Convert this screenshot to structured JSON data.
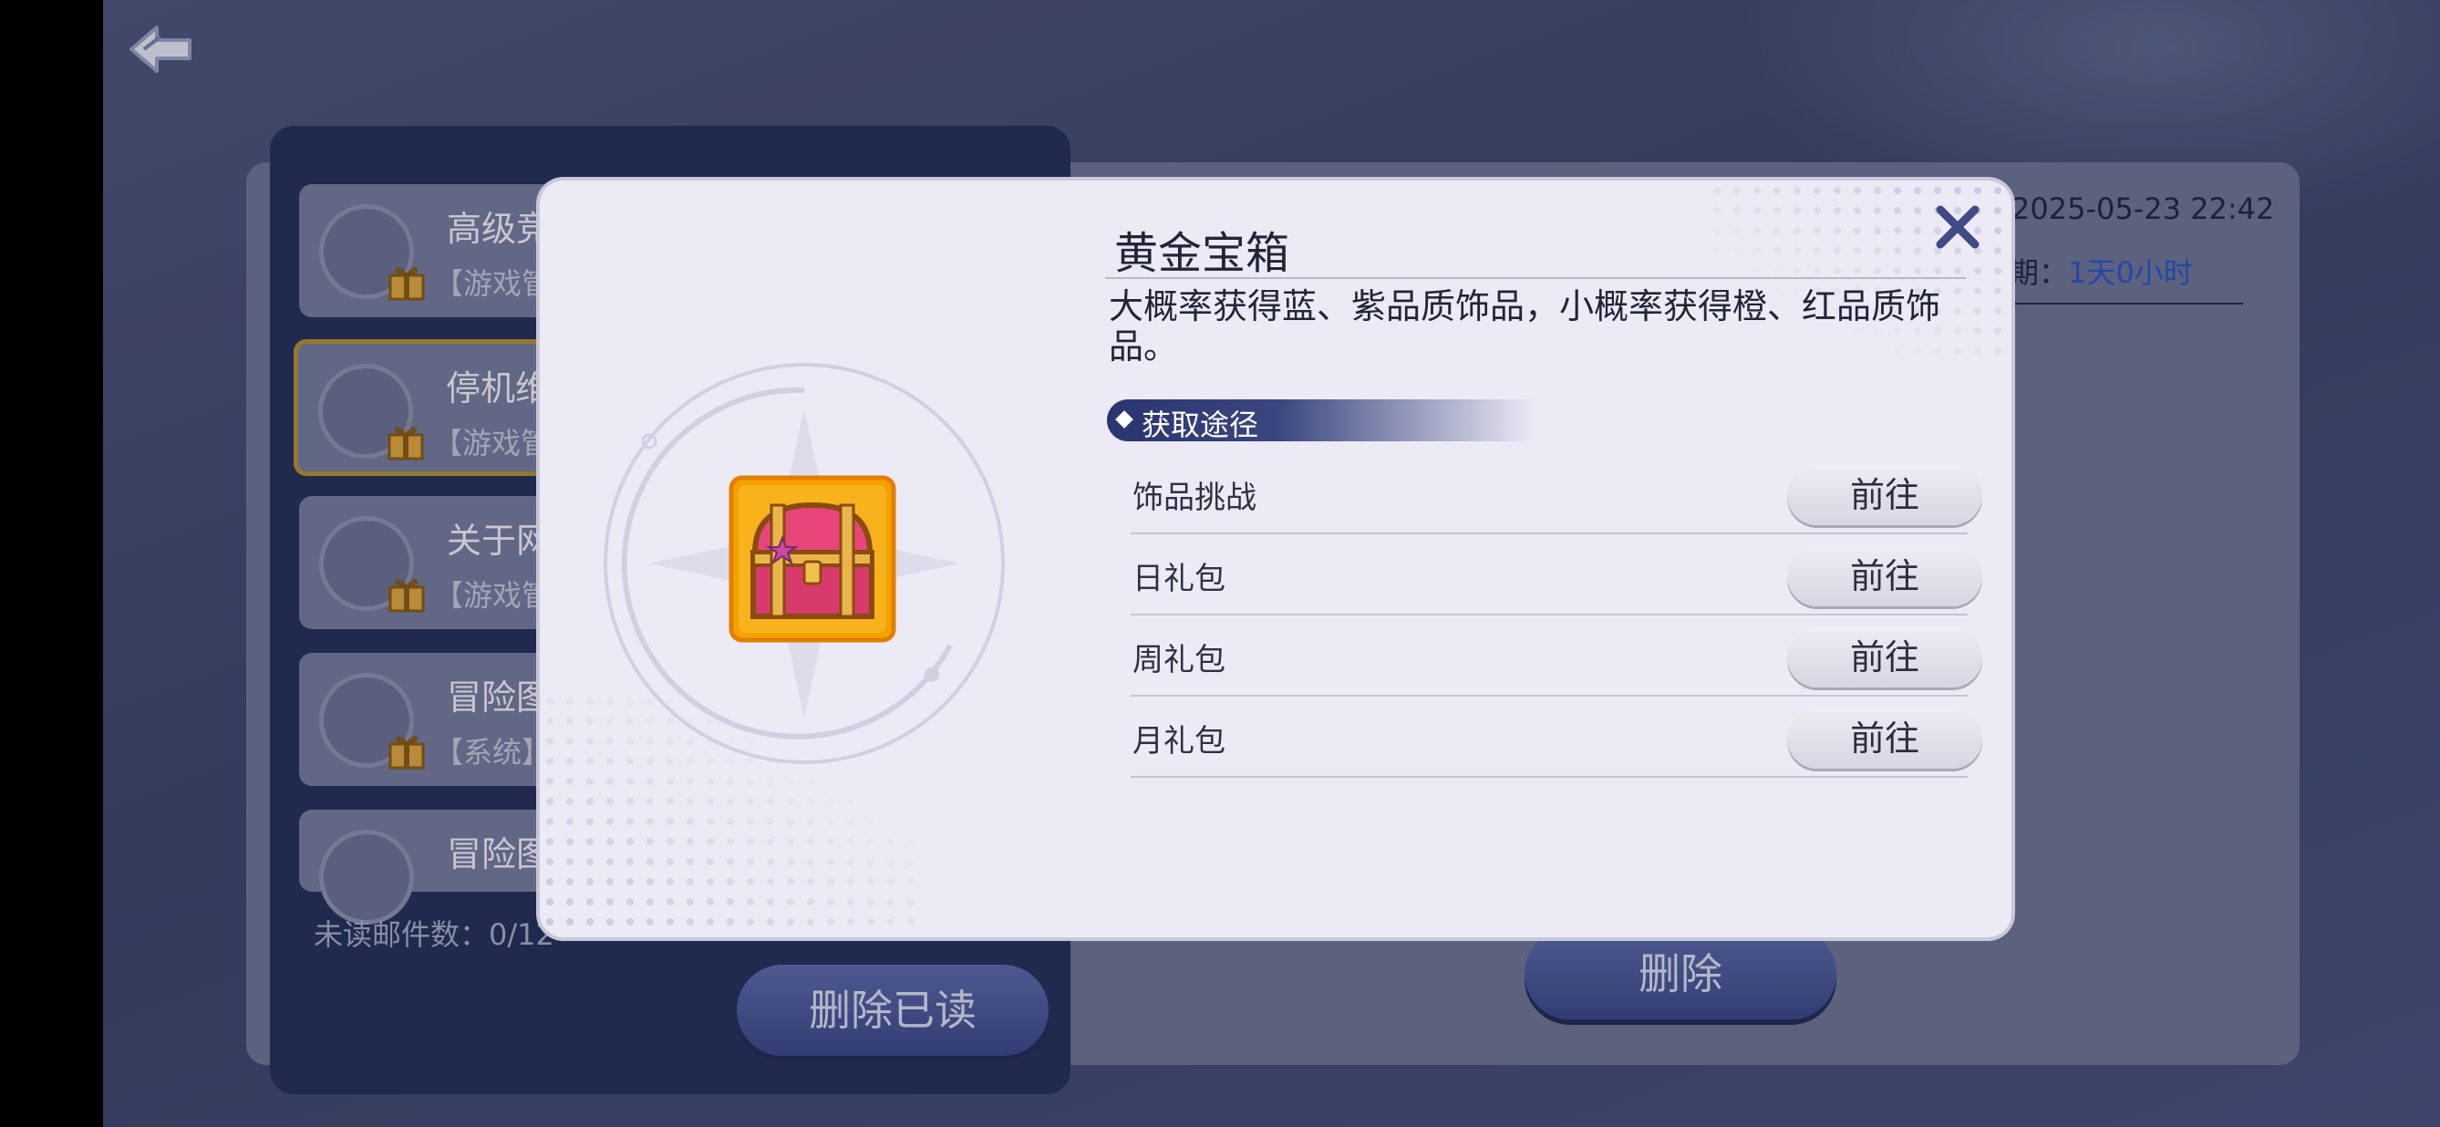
{
  "mail_list": {
    "items": [
      {
        "title": "高级竞",
        "sub": "【游戏管"
      },
      {
        "title": "停机维",
        "sub": "【游戏管"
      },
      {
        "title": "关于网",
        "sub": "【游戏管"
      },
      {
        "title": "冒险图",
        "sub": "【系统】"
      },
      {
        "title": "冒险图",
        "sub": ""
      }
    ],
    "unread_label": "未读邮件数：0/12",
    "delete_read_label": "删除已读"
  },
  "mail_detail": {
    "date": "2025-05-23 22:42",
    "expire_label": "期：",
    "expire_value": "1天0小时",
    "delete_label": "删除"
  },
  "modal": {
    "title": "黄金宝箱",
    "description": "大概率获得蓝、紫品质饰品，小概率获得橙、红品质饰品。",
    "source_header": "获取途径",
    "sources": [
      {
        "label": "饰品挑战",
        "button": "前往"
      },
      {
        "label": "日礼包",
        "button": "前往"
      },
      {
        "label": "周礼包",
        "button": "前往"
      },
      {
        "label": "月礼包",
        "button": "前往"
      }
    ],
    "item_icon": "golden-chest-icon"
  },
  "colors": {
    "accent_blue": "#2a55c7",
    "panel_dark": "#253058",
    "selected_border": "#b6902f",
    "chest_gold": "#f5a200",
    "chest_pink": "#e8457a"
  }
}
